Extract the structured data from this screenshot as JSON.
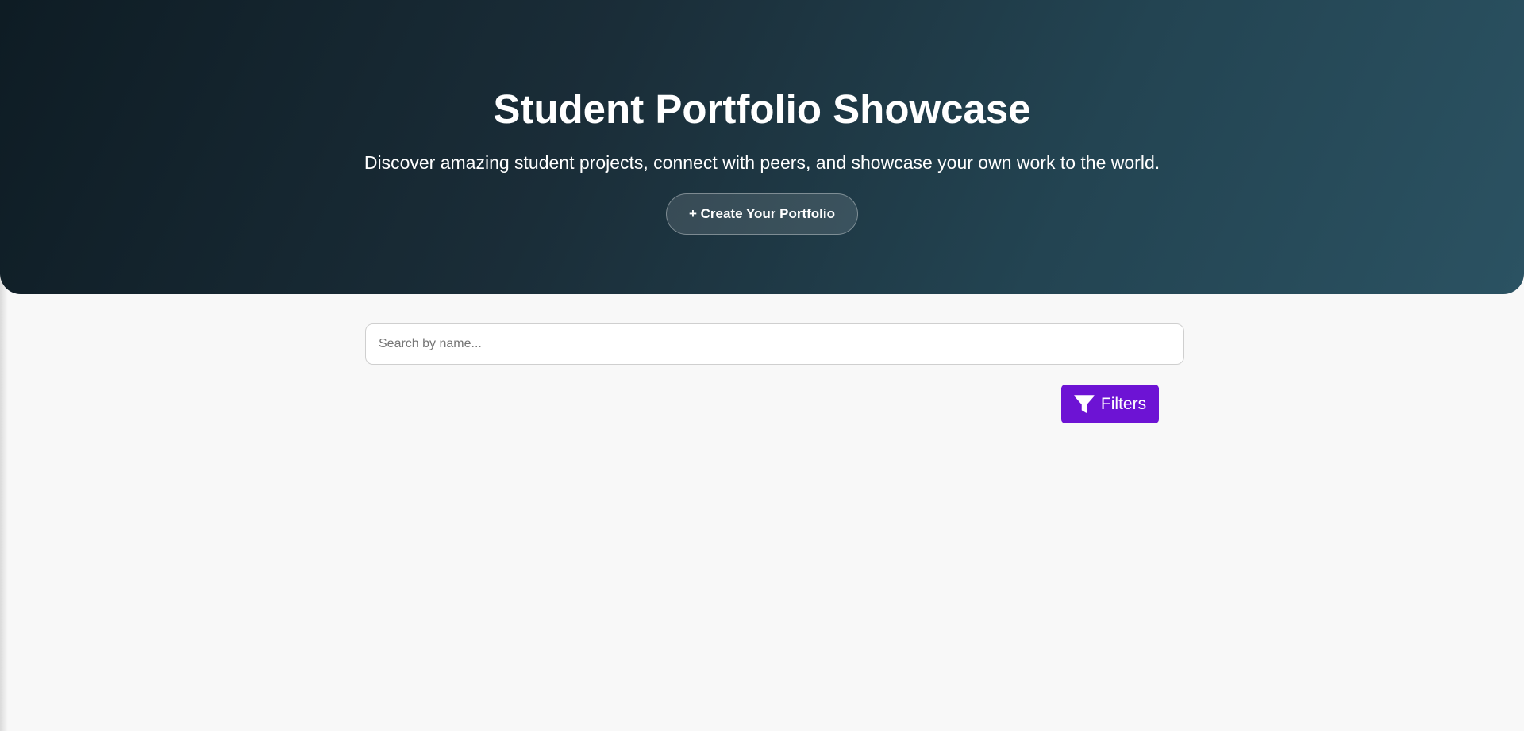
{
  "hero": {
    "title": "Student Portfolio Showcase",
    "subtitle": "Discover amazing student projects, connect with peers, and showcase your own work to the world.",
    "cta_label": "+ Create Your Portfolio"
  },
  "search": {
    "placeholder": "Search by name...",
    "value": ""
  },
  "filters": {
    "label": "Filters",
    "icon": "filter-icon"
  },
  "colors": {
    "hero_gradient_start": "#0e1c24",
    "hero_gradient_end": "#2b5262",
    "filters_button": "#6d13d4",
    "page_background": "#f8f8f8"
  }
}
